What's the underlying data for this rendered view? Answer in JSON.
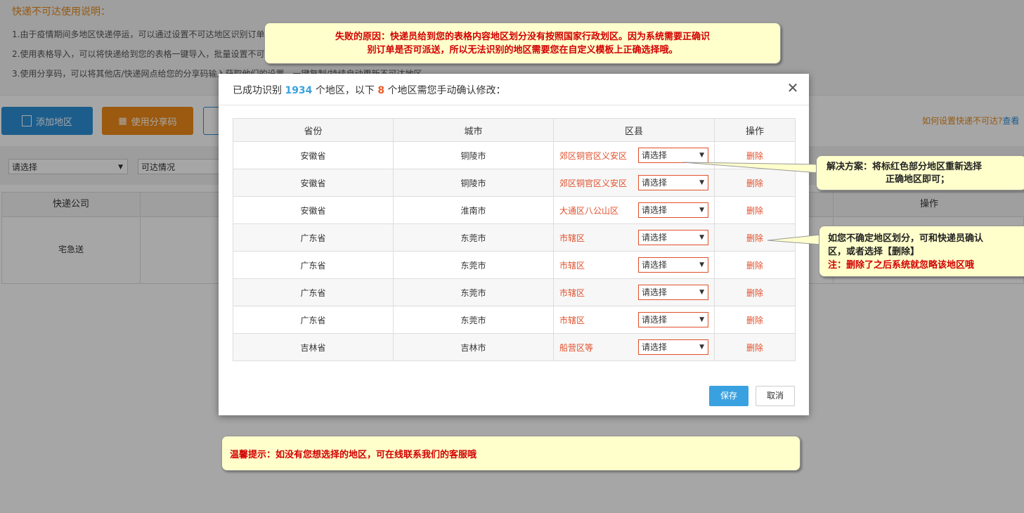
{
  "background": {
    "notice_title": "快递不可达使用说明：",
    "notice_lines": [
      "1.由于疫情期间多地区快递停运，可以通过设置不可达地区识别订单",
      "2.使用表格导入，可以将快递给到您的表格一键导入，批量设置不可",
      "3.使用分享码，可以将其他店/快递网点给您的分享码输入获取他们的设置，一键复制/持续自动更新不可达地区"
    ],
    "add_button": "添加地区",
    "share_button": "使用分享码",
    "help_text": "如何设置快递不可达?",
    "help_link": "查看",
    "filter_select_1": "请选择",
    "filter_select_2": "可达情况",
    "table_headers": [
      "快递公司",
      "操作"
    ],
    "row_company": "宅急送"
  },
  "modal": {
    "title_prefix": "已成功识别",
    "recognized_count": "1934",
    "title_mid": "个地区，以下",
    "manual_count": "8",
    "title_suffix": "个地区需您手动确认修改：",
    "columns": [
      "省份",
      "城市",
      "区县",
      "操作"
    ],
    "rows": [
      {
        "province": "安徽省",
        "city": "铜陵市",
        "district": "郊区铜官区义安区",
        "select": "请选择",
        "action": "删除"
      },
      {
        "province": "安徽省",
        "city": "铜陵市",
        "district": "郊区铜官区义安区",
        "select": "请选择",
        "action": "删除"
      },
      {
        "province": "安徽省",
        "city": "淮南市",
        "district": "大通区八公山区",
        "select": "请选择",
        "action": "删除"
      },
      {
        "province": "广东省",
        "city": "东莞市",
        "district": "市辖区",
        "select": "请选择",
        "action": "删除"
      },
      {
        "province": "广东省",
        "city": "东莞市",
        "district": "市辖区",
        "select": "请选择",
        "action": "删除"
      },
      {
        "province": "广东省",
        "city": "东莞市",
        "district": "市辖区",
        "select": "请选择",
        "action": "删除"
      },
      {
        "province": "广东省",
        "city": "东莞市",
        "district": "市辖区",
        "select": "请选择",
        "action": "删除"
      },
      {
        "province": "吉林省",
        "city": "吉林市",
        "district": "船营区等",
        "select": "请选择",
        "action": "删除"
      }
    ],
    "save_label": "保存",
    "cancel_label": "取消"
  },
  "callouts": {
    "failure_line1": "失败的原因：快递员给到您的表格内容地区划分没有按照国家行政划区。因为系统需要正确识",
    "failure_line2": "别订单是否可派送，所以无法识别的地区需要您在自定义模板上正确选择哦。",
    "solution_line1": "解决方案：将标红色部分地区重新选择",
    "solution_line2": "正确地区即可；",
    "unsure_line1": "如您不确定地区划分，可和快递员确认",
    "unsure_line2": "区，或者选择【删除】",
    "unsure_line3": "注：删除了之后系统就忽略该地区哦",
    "tip": "温馨提示：如没有您想选择的地区，可在线联系我们的客服哦"
  },
  "colors": {
    "accent_blue": "#3aa1e0",
    "warning_red": "#e0502b",
    "callout_bg": "#ffffcc",
    "orange": "#ef8a1a"
  }
}
